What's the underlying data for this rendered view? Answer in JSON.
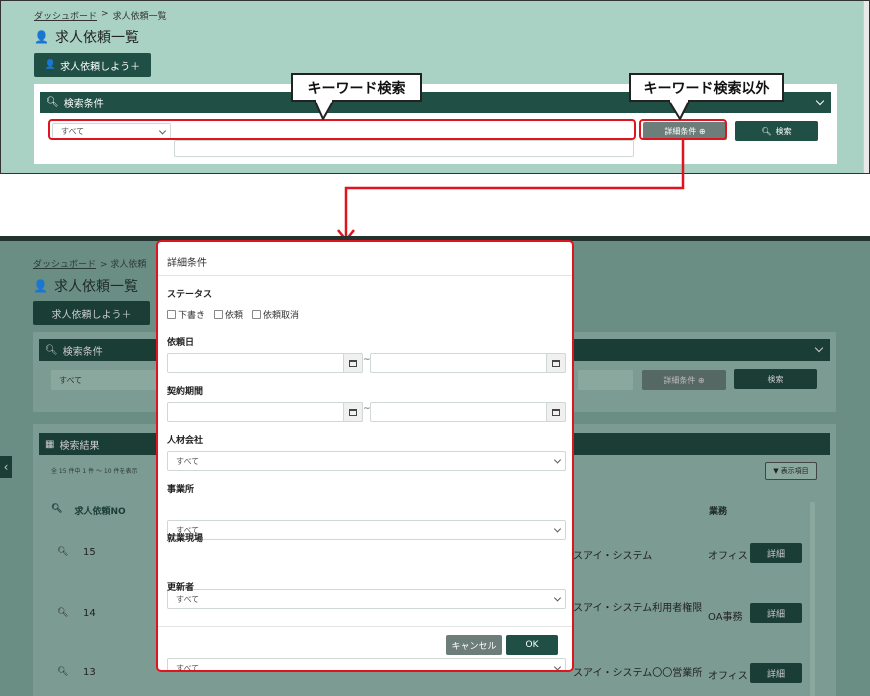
{
  "top": {
    "breadcrumb_link": "ダッシュボード",
    "breadcrumb_sep": ">",
    "breadcrumb_current": "求人依頼一覧",
    "page_title": "求人依頼一覧",
    "new_button": "求人依頼しよう＋",
    "search_panel_title": "検索条件",
    "keyword_select": "すべて",
    "detail_button": "詳細条件 ⊕",
    "search_button": "検索"
  },
  "callouts": {
    "keyword": "キーワード検索",
    "other": "キーワード検索以外"
  },
  "bottom": {
    "breadcrumb_link": "ダッシュボード",
    "breadcrumb_rest": "> 求人依頼",
    "page_title": "求人依頼一覧",
    "new_button": "求人依頼しよう＋",
    "search_panel_title": "検索条件",
    "keyword_select": "すべて",
    "detail_button": "詳細条件 ⊕",
    "search_button": "検索",
    "results_title": "検索結果",
    "count_text": "全 15 件中 1 件 ～ 10 件を表示",
    "columns_button": "表示項目",
    "col_no": "求人依頼NO",
    "col_business": "業務",
    "rows": [
      {
        "no": "15",
        "job": "スアイ・システム",
        "business": "オフィス",
        "action": "詳細"
      },
      {
        "no": "14",
        "job": "スアイ・システム利用者権限",
        "business": "OA事務",
        "action": "詳細"
      },
      {
        "no": "13",
        "job": "スアイ・システム〇〇営業所",
        "business": "オフィス",
        "action": "詳細"
      }
    ]
  },
  "modal": {
    "title": "詳細条件",
    "status_label": "ステータス",
    "status_options": [
      "下書き",
      "依頼",
      "依頼取消"
    ],
    "request_date_label": "依頼日",
    "contract_period_label": "契約期間",
    "range_sep": "~",
    "agency_label": "人材会社",
    "agency_value": "すべて",
    "office_label": "事業所",
    "office_value": "すべて",
    "site_label": "就業現場",
    "site_value": "すべて",
    "updater_label": "更新者",
    "updater_value": "すべて",
    "cancel_button": "キャンセル",
    "ok_button": "OK"
  },
  "colors": {
    "primary": "#1f4f45",
    "header_bg": "#a9d2c4",
    "overlay_bg": "#6a8e84",
    "highlight": "#e0141e"
  }
}
